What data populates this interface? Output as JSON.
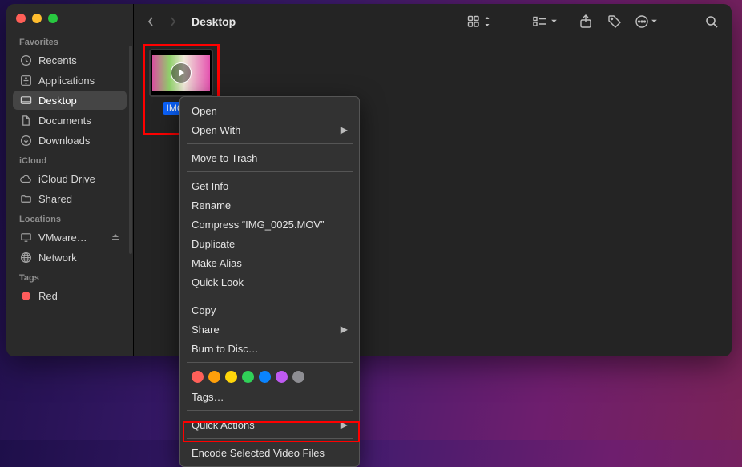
{
  "window": {
    "title": "Desktop"
  },
  "sidebar": {
    "sections": {
      "favorites": {
        "title": "Favorites",
        "items": [
          {
            "label": "Recents",
            "icon": "clock-icon"
          },
          {
            "label": "Applications",
            "icon": "app-grid-icon"
          },
          {
            "label": "Desktop",
            "icon": "desktop-icon",
            "selected": true
          },
          {
            "label": "Documents",
            "icon": "document-icon"
          },
          {
            "label": "Downloads",
            "icon": "downloads-icon"
          }
        ]
      },
      "icloud": {
        "title": "iCloud",
        "items": [
          {
            "label": "iCloud Drive",
            "icon": "cloud-icon"
          },
          {
            "label": "Shared",
            "icon": "folder-shared-icon"
          }
        ]
      },
      "locations": {
        "title": "Locations",
        "items": [
          {
            "label": "VMware…",
            "icon": "display-icon",
            "locked": true
          },
          {
            "label": "Network",
            "icon": "globe-icon"
          }
        ]
      },
      "tags": {
        "title": "Tags",
        "items": [
          {
            "label": "Red",
            "color": "#ff5c5c"
          }
        ]
      }
    }
  },
  "file": {
    "name": "IMG_0025.MOV",
    "display_name": "IMG_0"
  },
  "context_menu": {
    "items": [
      {
        "label": "Open"
      },
      {
        "label": "Open With",
        "submenu": true
      },
      {
        "sep": true
      },
      {
        "label": "Move to Trash"
      },
      {
        "sep": true
      },
      {
        "label": "Get Info"
      },
      {
        "label": "Rename"
      },
      {
        "label": "Compress “IMG_0025.MOV”"
      },
      {
        "label": "Duplicate"
      },
      {
        "label": "Make Alias"
      },
      {
        "label": "Quick Look"
      },
      {
        "sep": true
      },
      {
        "label": "Copy"
      },
      {
        "label": "Share",
        "submenu": true
      },
      {
        "label": "Burn to Disc…"
      },
      {
        "sep": true
      },
      {
        "tags": true,
        "colors": [
          "#ff6059",
          "#ffbd2e",
          "#ffd93b",
          "#28c840",
          "#34aadc",
          "#af52de",
          "#8e8e93"
        ]
      },
      {
        "label": "Tags…"
      },
      {
        "sep": true
      },
      {
        "label": "Quick Actions",
        "submenu": true
      },
      {
        "sep": true
      },
      {
        "label": "Encode Selected Video Files"
      }
    ]
  },
  "toolbar": {
    "view_icons": "view-icons-button",
    "view_list": "view-list-button",
    "share": "share-button",
    "tags": "tags-button",
    "more": "more-button",
    "search": "search-button"
  }
}
